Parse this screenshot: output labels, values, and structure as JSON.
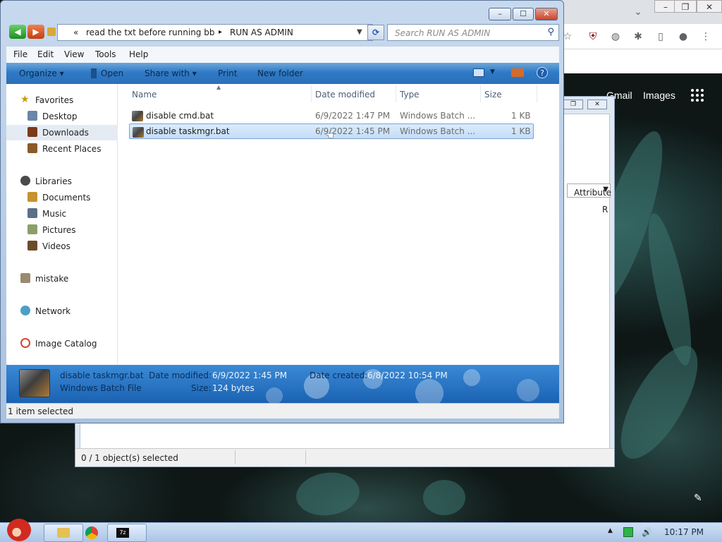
{
  "browser": {
    "links": [
      "Gmail",
      "Images"
    ],
    "icons": [
      "chevron-down-icon",
      "minimize-icon",
      "restore-icon",
      "close-icon",
      "ublock-icon",
      "extension-icon",
      "puzzle-icon",
      "sidepanel-icon",
      "profile-icon",
      "kebab-menu-icon",
      "apps-grid-icon"
    ]
  },
  "win2": {
    "attributes_header": "Attribute",
    "row_char": "R",
    "status_left": "0 / 1 object(s) selected"
  },
  "explorer": {
    "breadcrumb": {
      "prefix": "«",
      "parts": [
        "read the txt before running bb",
        "RUN AS ADMIN"
      ],
      "separator": "▸"
    },
    "search_placeholder": "Search RUN AS ADMIN",
    "menu": [
      "File",
      "Edit",
      "View",
      "Tools",
      "Help"
    ],
    "commands": [
      "Organize ▾",
      "Open",
      "Share with ▾",
      "Print",
      "New folder"
    ],
    "nav": {
      "favorites_header": "Favorites",
      "favorites": [
        "Desktop",
        "Downloads",
        "Recent Places"
      ],
      "libraries_header": "Libraries",
      "libraries": [
        "Documents",
        "Music",
        "Pictures",
        "Videos"
      ],
      "mistake": "mistake",
      "network": "Network",
      "image_catalog": "Image Catalog"
    },
    "columns": [
      "Name",
      "Date modified",
      "Type",
      "Size"
    ],
    "files": [
      {
        "name": "disable cmd.bat",
        "date": "6/9/2022 1:47 PM",
        "type": "Windows Batch ...",
        "size": "1 KB"
      },
      {
        "name": "disable taskmgr.bat",
        "date": "6/9/2022 1:45 PM",
        "type": "Windows Batch ...",
        "size": "1 KB"
      }
    ],
    "details": {
      "filename": "disable taskmgr.bat",
      "filetype": "Windows Batch File",
      "modified_label": "Date modified:",
      "modified_value": "6/9/2022 1:45 PM",
      "created_label": "Date created:",
      "created_value": "6/8/2022 10:54 PM",
      "size_label": "Size:",
      "size_value": "124 bytes"
    },
    "status": "1 item selected"
  },
  "taskbar": {
    "clock": "10:17 PM",
    "pinned": [
      "explorer-icon",
      "chrome-icon",
      "7zip-icon"
    ]
  },
  "colors": {
    "accent_blue": "#2b6fb8",
    "selection": "#c4ddf6",
    "close_red": "#c6452d"
  }
}
